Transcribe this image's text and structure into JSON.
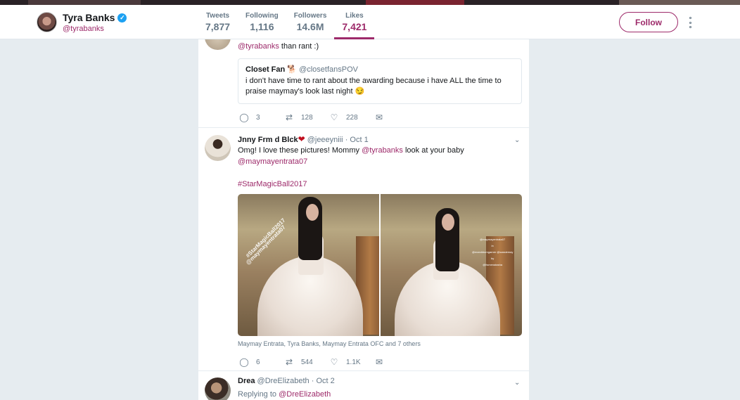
{
  "profile": {
    "name": "Tyra Banks",
    "handle": "@tyrabanks",
    "follow_label": "Follow"
  },
  "stats": [
    {
      "label": "Tweets",
      "value": "7,877"
    },
    {
      "label": "Following",
      "value": "1,116"
    },
    {
      "label": "Followers",
      "value": "14.6M"
    },
    {
      "label": "Likes",
      "value": "7,421"
    }
  ],
  "tweet1": {
    "text_link": "@tyrabanks",
    "text_rest": " than rant :)",
    "quote": {
      "name": "Closet Fan",
      "emoji": "🐕",
      "handle": "@closetfansPOV",
      "body": "i don't have time to rant about the awarding because i have ALL the time to praise maymay's look last night",
      "body_emoji": "😏"
    },
    "replies": "3",
    "retweets": "128",
    "likes": "228"
  },
  "tweet2": {
    "name": "Jnny Frm d Blck",
    "handle": "@jeeeyniii",
    "date": "· Oct 1",
    "line1_pre": "Omg! I love these pictures! Mommy ",
    "line1_link": "@tyrabanks",
    "line1_post": " look at your baby",
    "line2_link": "@maymayentrata07",
    "hashtag": "#StarMagicBall2017",
    "photo1_watermark_a": "#StarMagicBall2017",
    "photo1_watermark_b": "@maymayentrata07",
    "photo2_watermark": "@maymayentrata07\nin\n@marckbumgarner @sassiemay\nby\n@itsmenatasha",
    "tagged": "Maymay Entrata, Tyra Banks, Maymay Entrata OFC and 7 others",
    "replies": "6",
    "retweets": "544",
    "likes": "1.1K"
  },
  "tweet3": {
    "name": "Drea",
    "handle": "@DreElizabeth",
    "date": "· Oct 2",
    "replying_label": "Replying to ",
    "replying_link": "@DreElizabeth"
  },
  "colors": {
    "accent": "#9d2a6a",
    "verified": "#1da1f2",
    "background": "#e6ecf0"
  }
}
